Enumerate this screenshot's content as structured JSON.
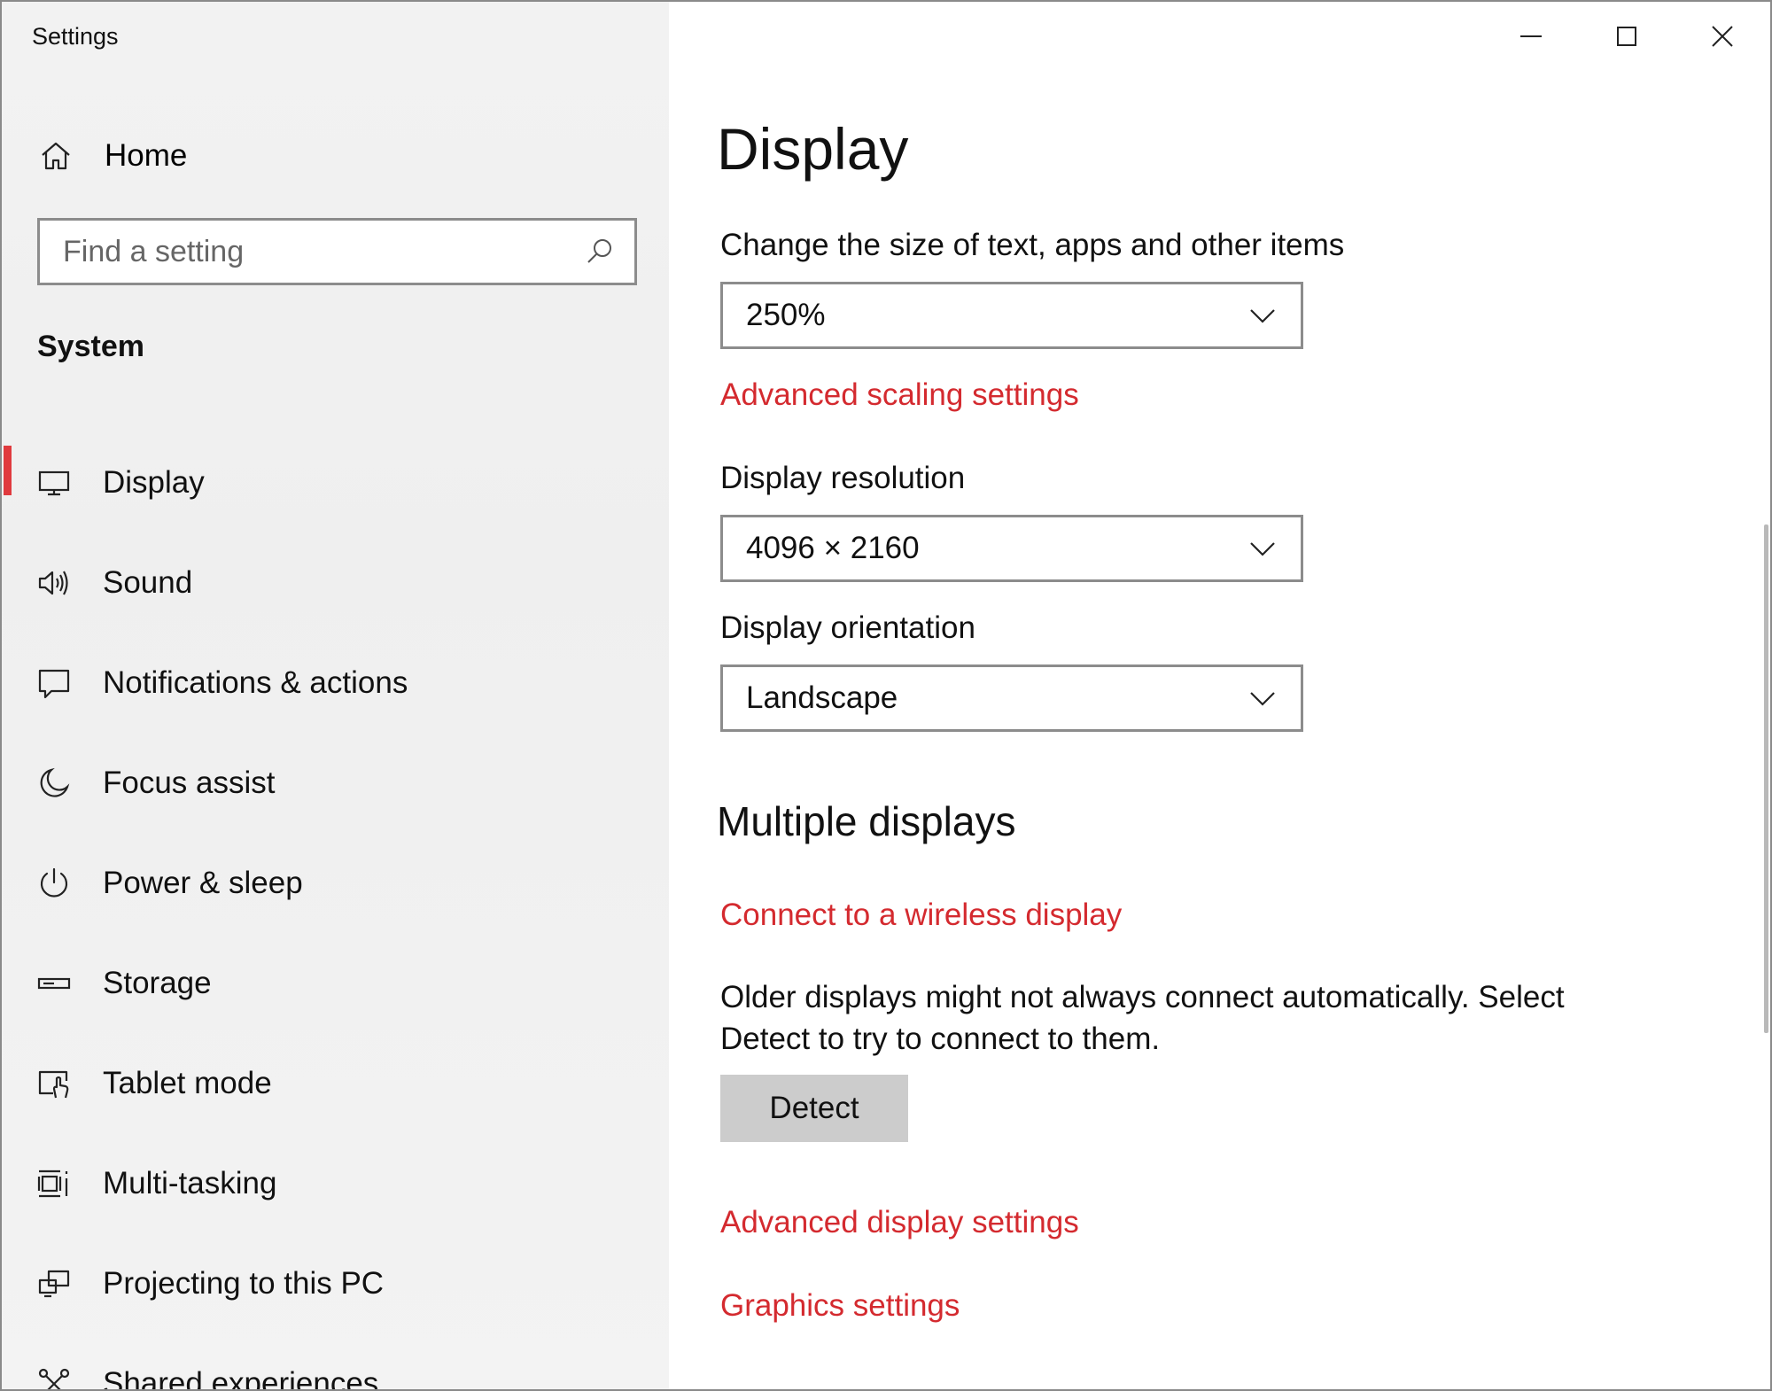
{
  "window": {
    "title": "Settings"
  },
  "sidebar": {
    "home_label": "Home",
    "search_placeholder": "Find a setting",
    "section_title": "System",
    "items": [
      {
        "label": "Display",
        "icon": "monitor-icon",
        "active": true
      },
      {
        "label": "Sound",
        "icon": "speaker-icon"
      },
      {
        "label": "Notifications & actions",
        "icon": "notification-icon"
      },
      {
        "label": "Focus assist",
        "icon": "moon-icon"
      },
      {
        "label": "Power & sleep",
        "icon": "power-icon"
      },
      {
        "label": "Storage",
        "icon": "storage-icon"
      },
      {
        "label": "Tablet mode",
        "icon": "tablet-mode-icon"
      },
      {
        "label": "Multi-tasking",
        "icon": "multitasking-icon"
      },
      {
        "label": "Projecting to this PC",
        "icon": "projecting-icon"
      },
      {
        "label": "Shared experiences",
        "icon": "shared-experiences-icon"
      }
    ],
    "accent_color": "#e03a3e"
  },
  "main": {
    "title": "Display",
    "scale": {
      "label": "Change the size of text, apps and other items",
      "value": "250%"
    },
    "advanced_scaling_link": "Advanced scaling settings",
    "resolution": {
      "label": "Display resolution",
      "value": "4096 × 2160"
    },
    "orientation": {
      "label": "Display orientation",
      "value": "Landscape"
    },
    "multiple_displays": {
      "heading": "Multiple displays",
      "wireless_link": "Connect to a wireless display",
      "description": "Older displays might not always connect automatically. Select Detect to try to connect to them.",
      "detect_button": "Detect"
    },
    "advanced_display_link": "Advanced display settings",
    "graphics_link": "Graphics settings",
    "link_color": "#d42a2f"
  }
}
